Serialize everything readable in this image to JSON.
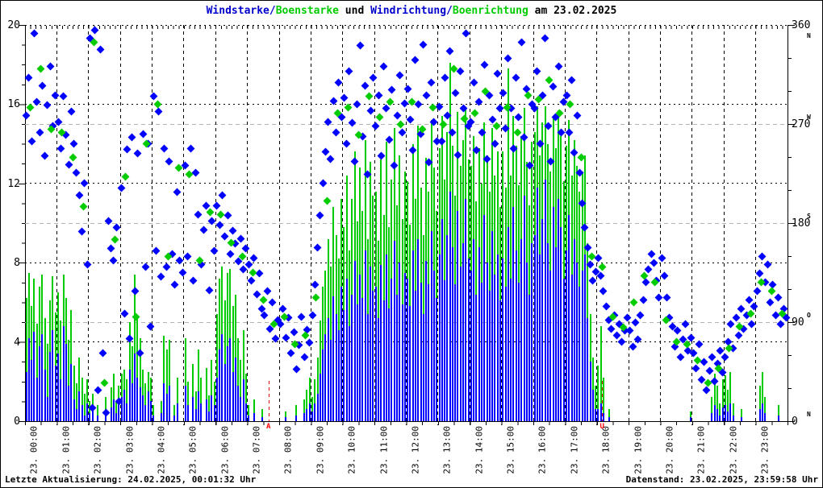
{
  "window": {
    "background": "#ffffff",
    "border_color": "#000000"
  },
  "title": {
    "full_text": "Windstarke/Boenstarke und Windrichtung/Boenrichtung am 23.02.2025",
    "segments": [
      {
        "text": "Windstarke/",
        "color": "#0000cc"
      },
      {
        "text": "Boenstarke",
        "color": "#00cc00"
      },
      {
        "text": " und ",
        "color": "#000000"
      },
      {
        "text": "Windrichtung/",
        "color": "#0000cc"
      },
      {
        "text": "Boenrichtung",
        "color": "#00cc00"
      },
      {
        "text": " am 23.02.2025",
        "color": "#000000"
      }
    ]
  },
  "footer": {
    "left": "Letzte Aktualisierung: 24.02.2025, 00:01:32 Uhr",
    "right": "Datenstand: 23.02.2025, 23:59:58 Uhr"
  },
  "colors": {
    "wind": "#0000ff",
    "gust": "#00cc00",
    "grid_black": "#000000",
    "grid_gray": "#b3b3b3",
    "sun_marker": "#ff0000"
  },
  "chart_data": {
    "type": "mixed",
    "subtypes": {
      "speed": "impulse-bar",
      "direction": "scatter"
    },
    "title": "Windstarke/Boenstarke und Windrichtung/Boenrichtung am 23.02.2025",
    "ylim_left": [
      0,
      20
    ],
    "ylim_right": [
      0,
      360
    ],
    "yticks_left": [
      0,
      4,
      8,
      12,
      16,
      20
    ],
    "yticks_right": [
      {
        "value": 0,
        "compass": "N"
      },
      {
        "value": 90,
        "compass": "O"
      },
      {
        "value": 180,
        "compass": "S"
      },
      {
        "value": 270,
        "compass": "W"
      },
      {
        "value": 360,
        "compass": "N"
      }
    ],
    "grid": {
      "vertical": "hourly dashed black",
      "speed_lines": "dotted black at 4,8,12,16,20",
      "direction_lines": "dashed gray at 90,180,270"
    },
    "xticks": [
      "23. 00:00",
      "23. 01:00",
      "23. 02:00",
      "23. 03:00",
      "23. 04:00",
      "23. 05:00",
      "23. 06:00",
      "23. 07:00",
      "23. 08:00",
      "23. 09:00",
      "23. 10:00",
      "23. 11:00",
      "23. 12:00",
      "23. 13:00",
      "23. 14:00",
      "23. 15:00",
      "23. 16:00",
      "23. 17:00",
      "23. 18:00",
      "23. 19:00",
      "23. 20:00",
      "23. 21:00",
      "23. 22:00",
      "23. 23:00"
    ],
    "x_hours_total": 24,
    "sun_markers": [
      {
        "label": "A",
        "hour": 7.67
      },
      {
        "label": "U",
        "hour": 18.17
      }
    ],
    "series": [
      {
        "name": "Windstarke",
        "type": "impulse-bar",
        "axis": "left",
        "color": "#0000ff",
        "interval_min": 5,
        "values": [
          2.5,
          4.2,
          3.1,
          4.5,
          2.2,
          3.8,
          4.4,
          2.6,
          1.2,
          3.5,
          4.6,
          2.8,
          3.4,
          2.1,
          4.8,
          3.9,
          1.8,
          2.9,
          1.1,
          0.6,
          1.5,
          0.8,
          0.3,
          0.9,
          0.4,
          0.6,
          0,
          0.3,
          0,
          0,
          0.5,
          0,
          0.7,
          1.1,
          0.4,
          0.8,
          1.2,
          1.6,
          0.9,
          2.6,
          1.9,
          3.4,
          2.2,
          1.7,
          1.3,
          0.8,
          1.5,
          1.0,
          0.3,
          0,
          0,
          0.4,
          1.9,
          1.4,
          1.8,
          0,
          0.3,
          0.9,
          0,
          0,
          1.8,
          0.8,
          0,
          1.2,
          0.6,
          1.5,
          0.9,
          0,
          1.1,
          0.5,
          1.3,
          0.8,
          2.2,
          3.6,
          4.4,
          2.9,
          3.8,
          4.2,
          2.5,
          3.2,
          1.8,
          1.2,
          2.1,
          0.9,
          0.3,
          0,
          0.4,
          0,
          0,
          0.2,
          0,
          0,
          0,
          0,
          0,
          0,
          0,
          0,
          0.2,
          0,
          0,
          0,
          0.3,
          0,
          0,
          0.4,
          0.6,
          0.9,
          0.5,
          0.9,
          1.4,
          2.4,
          3.6,
          4.4,
          5.2,
          4.1,
          6.3,
          5.4,
          4.6,
          6.8,
          5.6,
          7.2,
          4.8,
          6.4,
          8.1,
          5.9,
          7.4,
          6.2,
          8.6,
          5.4,
          7.8,
          6.6,
          6.8,
          5.2,
          7.9,
          6.1,
          8.4,
          5.7,
          7.2,
          9.1,
          6.4,
          8.0,
          5.9,
          7.5,
          7.2,
          5.8,
          8.6,
          6.6,
          9.2,
          7.0,
          5.4,
          8.1,
          6.9,
          9.6,
          7.6,
          6.2,
          8.4,
          10.2,
          7.1,
          9.4,
          11.6,
          8.8,
          6.9,
          10.6,
          7.8,
          9.0,
          11.2,
          8.2,
          7.6,
          9.2,
          6.4,
          8.8,
          7.0,
          10.4,
          8.0,
          6.6,
          9.6,
          7.4,
          8.4,
          6.1,
          8.2,
          6.8,
          9.8,
          7.2,
          10.8,
          8.6,
          7.0,
          9.2,
          11.4,
          8.0,
          6.4,
          9.0,
          9.4,
          11.8,
          8.4,
          10.2,
          12.2,
          9.0,
          7.6,
          10.8,
          8.8,
          11.2,
          9.8,
          7.2,
          8.6,
          10.4,
          7.4,
          9.2,
          8.0,
          6.8,
          7.6,
          8.4,
          5.2,
          3.0,
          1.6,
          0.6,
          0.6,
          0.9,
          0.4,
          0,
          0.2,
          0,
          0,
          0,
          0,
          0,
          0,
          0,
          0,
          0,
          0,
          0,
          0,
          0,
          0,
          0,
          0,
          0,
          0,
          0,
          0,
          0,
          0,
          0,
          0,
          0,
          0,
          0,
          0,
          0,
          0,
          0.2,
          0,
          0,
          0,
          0,
          0,
          0,
          0,
          0.4,
          0.8,
          0.6,
          0.3,
          0.7,
          0.8,
          0.5,
          0.9,
          0.3,
          0,
          0,
          0.2,
          0,
          0,
          0,
          0,
          0,
          0,
          0.6,
          0.9,
          0.4,
          0,
          0,
          0,
          0,
          0.3,
          0,
          0,
          0
        ]
      },
      {
        "name": "Boenstarke",
        "type": "impulse-bar",
        "axis": "left",
        "color": "#00cc00",
        "interval_min": 5,
        "values": [
          6.2,
          7.5,
          5.8,
          7.2,
          4.9,
          6.8,
          7.4,
          5.2,
          3.9,
          6.1,
          7.3,
          5.5,
          6.5,
          5.1,
          7.4,
          6.2,
          4.1,
          5.6,
          2.8,
          1.9,
          3.2,
          2.2,
          1.4,
          2.1,
          1.0,
          1.4,
          0,
          0.8,
          0,
          0,
          1.2,
          0,
          1.7,
          2.4,
          1.0,
          1.8,
          2.4,
          2.6,
          2.1,
          5.0,
          3.8,
          7.4,
          5.2,
          4.2,
          2.6,
          1.9,
          2.5,
          2.2,
          0.8,
          0,
          0,
          1.0,
          4.3,
          3.6,
          4.1,
          0,
          0.8,
          2.2,
          0,
          0,
          4.2,
          2.0,
          0,
          2.9,
          1.5,
          3.6,
          2.2,
          0,
          2.7,
          1.3,
          3.1,
          2.0,
          5.4,
          7.2,
          7.8,
          6.1,
          7.5,
          7.7,
          5.8,
          6.4,
          4.2,
          3.1,
          4.6,
          2.4,
          0.8,
          0,
          1.1,
          0,
          0,
          0.6,
          0,
          0,
          0,
          0,
          0,
          0,
          0,
          0,
          0.5,
          0,
          0,
          0,
          0.8,
          0,
          0,
          1.1,
          1.6,
          2.2,
          1.2,
          2.1,
          3.2,
          5.1,
          6.8,
          7.6,
          9.2,
          7.8,
          10.8,
          9.4,
          8.2,
          11.2,
          9.8,
          12.4,
          8.6,
          11.2,
          13.6,
          10.1,
          12.8,
          10.6,
          14.2,
          9.2,
          13.1,
          11.4,
          11.6,
          9.1,
          13.2,
          10.4,
          14.1,
          9.8,
          12.2,
          14.8,
          10.9,
          13.4,
          10.2,
          12.6,
          12.1,
          9.9,
          14.0,
          11.2,
          14.9,
          11.8,
          9.4,
          13.3,
          11.6,
          15.2,
          12.8,
          10.6,
          13.8,
          15.4,
          12.2,
          14.6,
          18.1,
          13.9,
          11.4,
          15.6,
          12.9,
          14.2,
          15.8,
          13.2,
          12.9,
          14.4,
          11.1,
          13.8,
          12.0,
          15.1,
          13.4,
          11.6,
          14.8,
          12.4,
          13.6,
          10.8,
          13.6,
          11.8,
          17.8,
          12.4,
          15.4,
          13.9,
          11.9,
          14.4,
          15.8,
          13.1,
          10.9,
          14.1,
          14.6,
          15.9,
          13.4,
          15.1,
          15.9,
          14.0,
          12.6,
          15.4,
          13.8,
          15.7,
          14.4,
          12.1,
          13.9,
          15.2,
          12.4,
          14.2,
          12.9,
          11.6,
          12.6,
          13.4,
          9.0,
          5.4,
          3.2,
          1.8,
          2.8,
          4.8,
          2.2,
          0,
          0.6,
          0,
          0,
          0,
          0,
          0,
          0,
          0,
          0,
          0,
          0,
          0,
          0,
          0,
          0,
          0,
          0,
          0,
          0,
          0,
          0,
          0,
          0,
          0,
          0,
          0,
          0,
          0,
          0,
          0,
          0,
          0.5,
          0,
          0,
          0,
          0,
          0,
          0,
          0,
          1.2,
          2.4,
          1.8,
          0.9,
          2.1,
          2.3,
          1.6,
          2.5,
          0.9,
          0,
          0,
          0.6,
          0,
          0,
          0,
          0,
          0,
          0,
          1.8,
          2.5,
          1.2,
          0,
          0,
          0,
          0,
          0.8,
          0,
          0,
          0
        ]
      },
      {
        "name": "Windrichtung",
        "type": "scatter-diamond",
        "axis": "right",
        "color": "#0000ff",
        "interval_min": 5,
        "values": [
          278,
          312,
          254,
          352,
          290,
          262,
          305,
          241,
          287,
          322,
          268,
          296,
          272,
          248,
          295,
          260,
          233,
          281,
          252,
          226,
          205,
          172,
          216,
          142,
          348,
          12,
          355,
          28,
          338,
          62,
          8,
          182,
          157,
          146,
          176,
          18,
          212,
          98,
          247,
          75,
          258,
          118,
          243,
          62,
          261,
          140,
          252,
          86,
          295,
          155,
          281,
          131,
          248,
          140,
          236,
          152,
          124,
          208,
          146,
          135,
          232,
          150,
          248,
          128,
          226,
          188,
          142,
          174,
          196,
          119,
          182,
          155,
          196,
          178,
          205,
          168,
          187,
          152,
          173,
          161,
          145,
          166,
          138,
          157,
          142,
          128,
          148,
          115,
          134,
          102,
          96,
          118,
          84,
          108,
          75,
          92,
          88,
          102,
          76,
          94,
          62,
          81,
          47,
          69,
          95,
          58,
          83,
          71,
          96,
          124,
          158,
          187,
          216,
          245,
          272,
          238,
          291,
          262,
          308,
          276,
          294,
          252,
          318,
          271,
          236,
          288,
          341,
          259,
          305,
          224,
          282,
          312,
          268,
          296,
          241,
          322,
          284,
          256,
          301,
          232,
          278,
          314,
          262,
          289,
          302,
          274,
          246,
          328,
          288,
          261,
          342,
          296,
          235,
          308,
          272,
          254,
          286,
          254,
          312,
          278,
          336,
          262,
          298,
          242,
          318,
          284,
          352,
          268,
          272,
          308,
          246,
          290,
          262,
          324,
          238,
          296,
          274,
          252,
          316,
          284,
          298,
          266,
          330,
          284,
          248,
          312,
          276,
          344,
          258,
          302,
          232,
          288,
          284,
          318,
          252,
          296,
          348,
          268,
          236,
          304,
          276,
          322,
          262,
          290,
          296,
          262,
          310,
          244,
          278,
          226,
          198,
          176,
          158,
          142,
          128,
          136,
          148,
          132,
          118,
          104,
          92,
          84,
          96,
          78,
          88,
          72,
          82,
          94,
          82,
          68,
          90,
          74,
          96,
          110,
          126,
          138,
          152,
          144,
          128,
          112,
          148,
          132,
          112,
          94,
          86,
          68,
          82,
          58,
          74,
          88,
          64,
          76,
          62,
          48,
          70,
          38,
          54,
          28,
          46,
          58,
          36,
          52,
          64,
          44,
          58,
          72,
          88,
          66,
          94,
          78,
          102,
          84,
          96,
          110,
          88,
          104,
          118,
          134,
          150,
          126,
          142,
          108,
          124,
          96,
          112,
          88,
          102,
          94
        ]
      },
      {
        "name": "Boenrichtung",
        "type": "scatter-diamond",
        "axis": "right",
        "color": "#00cc00",
        "interval_min": 20,
        "values": [
          285,
          320,
          265,
          262,
          240,
          195,
          344,
          35,
          165,
          222,
          95,
          252,
          288,
          150,
          230,
          224,
          146,
          190,
          188,
          162,
          150,
          135,
          110,
          88,
          95,
          70,
          78,
          112,
          200,
          280,
          285,
          260,
          295,
          276,
          290,
          270,
          290,
          265,
          285,
          270,
          320,
          275,
          280,
          300,
          268,
          285,
          262,
          296,
          292,
          310,
          280,
          288,
          240,
          150,
          140,
          95,
          85,
          108,
          132,
          126,
          92,
          72,
          70,
          55,
          35,
          48,
          66,
          86,
          98,
          126,
          118,
          98
        ]
      }
    ]
  }
}
